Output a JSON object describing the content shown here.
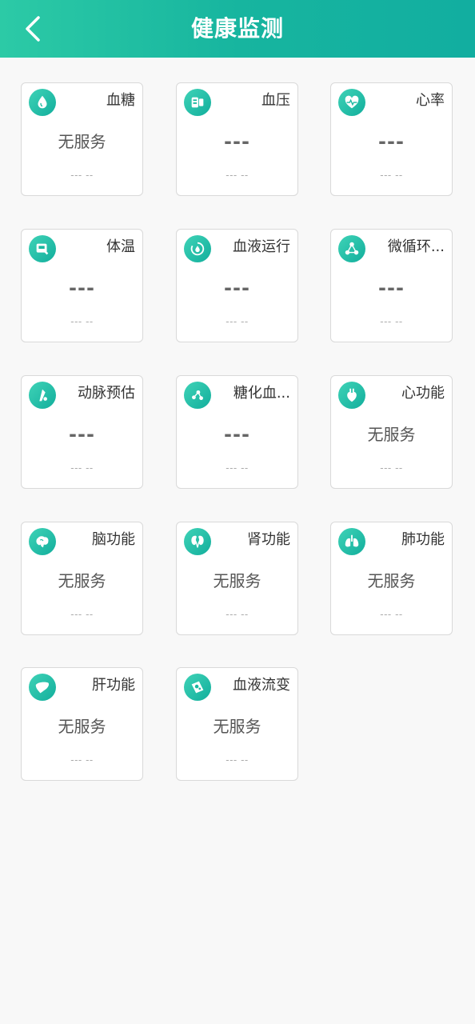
{
  "header": {
    "title": "健康监测",
    "back_icon": "chevron-left-icon"
  },
  "colors": {
    "header_start": "#2ccaa6",
    "header_end": "#12aea0",
    "icon_accent": "#1bb8a0"
  },
  "cards": [
    {
      "label": "血糖",
      "value": "无服务",
      "time": "--- --",
      "icon": "blood-drop-icon"
    },
    {
      "label": "血压",
      "value": "---",
      "time": "--- --",
      "icon": "blood-pressure-icon"
    },
    {
      "label": "心率",
      "value": "---",
      "time": "--- --",
      "icon": "heart-pulse-icon"
    },
    {
      "label": "体温",
      "value": "---",
      "time": "--- --",
      "icon": "thermometer-icon"
    },
    {
      "label": "血液运行",
      "value": "---",
      "time": "--- --",
      "icon": "circulation-icon"
    },
    {
      "label": "微循环...",
      "value": "---",
      "time": "--- --",
      "icon": "microcirculation-icon"
    },
    {
      "label": "动脉预估",
      "value": "---",
      "time": "--- --",
      "icon": "artery-icon"
    },
    {
      "label": "糖化血...",
      "value": "---",
      "time": "--- --",
      "icon": "molecule-icon"
    },
    {
      "label": "心功能",
      "value": "无服务",
      "time": "--- --",
      "icon": "heart-organ-icon"
    },
    {
      "label": "脑功能",
      "value": "无服务",
      "time": "--- --",
      "icon": "brain-icon"
    },
    {
      "label": "肾功能",
      "value": "无服务",
      "time": "--- --",
      "icon": "kidney-icon"
    },
    {
      "label": "肺功能",
      "value": "无服务",
      "time": "--- --",
      "icon": "lungs-icon"
    },
    {
      "label": "肝功能",
      "value": "无服务",
      "time": "--- --",
      "icon": "liver-icon"
    },
    {
      "label": "血液流变",
      "value": "无服务",
      "time": "--- --",
      "icon": "blood-flow-icon"
    }
  ]
}
